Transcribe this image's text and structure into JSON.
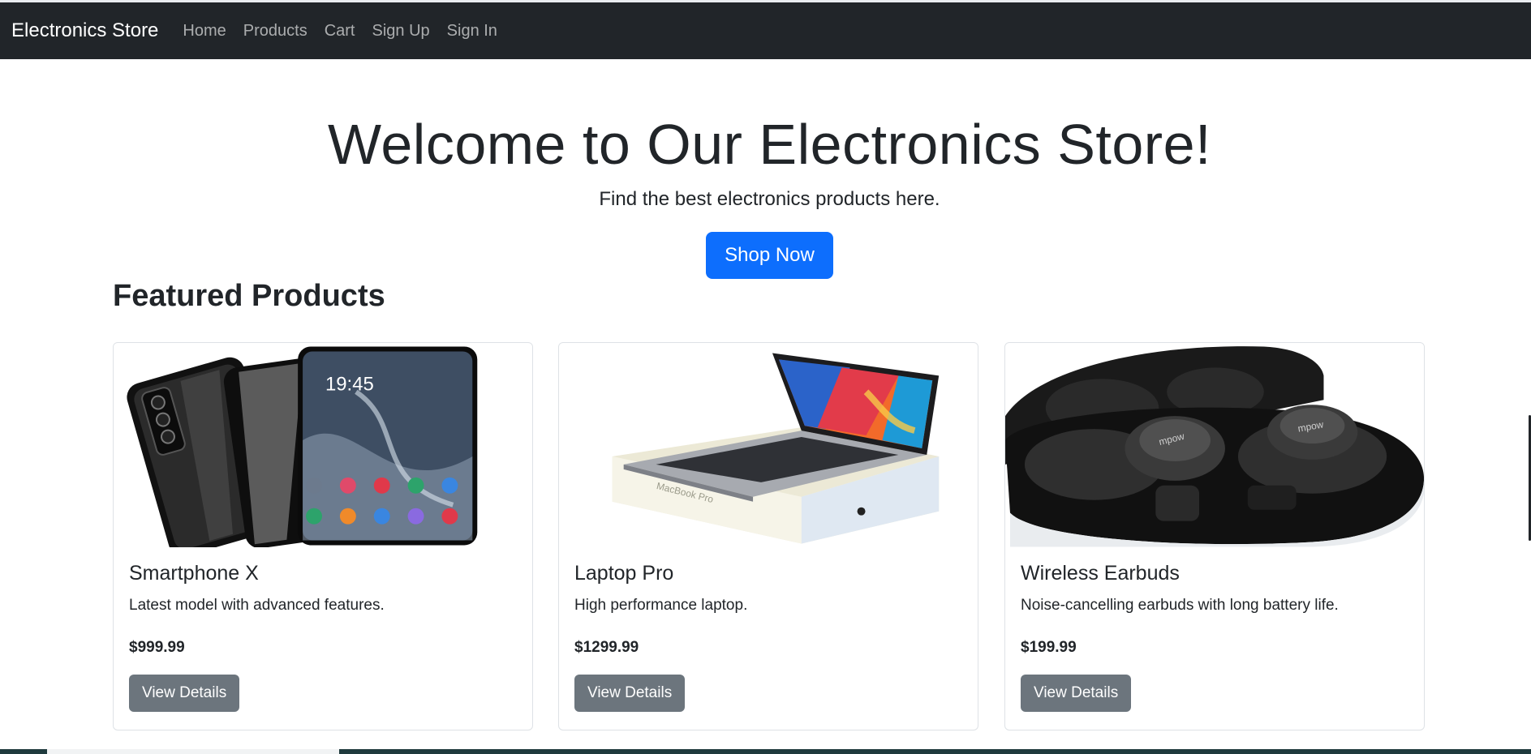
{
  "navbar": {
    "brand": "Electronics Store",
    "links": [
      "Home",
      "Products",
      "Cart",
      "Sign Up",
      "Sign In"
    ]
  },
  "hero": {
    "title": "Welcome to Our Electronics Store!",
    "subtitle": "Find the best electronics products here.",
    "button": "Shop Now"
  },
  "featured": {
    "title": "Featured Products",
    "products": [
      {
        "name": "Smartphone X",
        "description": "Latest model with advanced features.",
        "price": "$999.99",
        "button": "View Details"
      },
      {
        "name": "Laptop Pro",
        "description": "High performance laptop.",
        "price": "$1299.99",
        "button": "View Details"
      },
      {
        "name": "Wireless Earbuds",
        "description": "Noise-cancelling earbuds with long battery life.",
        "price": "$199.99",
        "button": "View Details"
      }
    ]
  },
  "colors": {
    "navbar_bg": "#212529",
    "primary": "#0d6efd",
    "secondary": "#6c757d"
  },
  "icons": [
    "smartphone-image",
    "laptop-image",
    "earbuds-image"
  ]
}
